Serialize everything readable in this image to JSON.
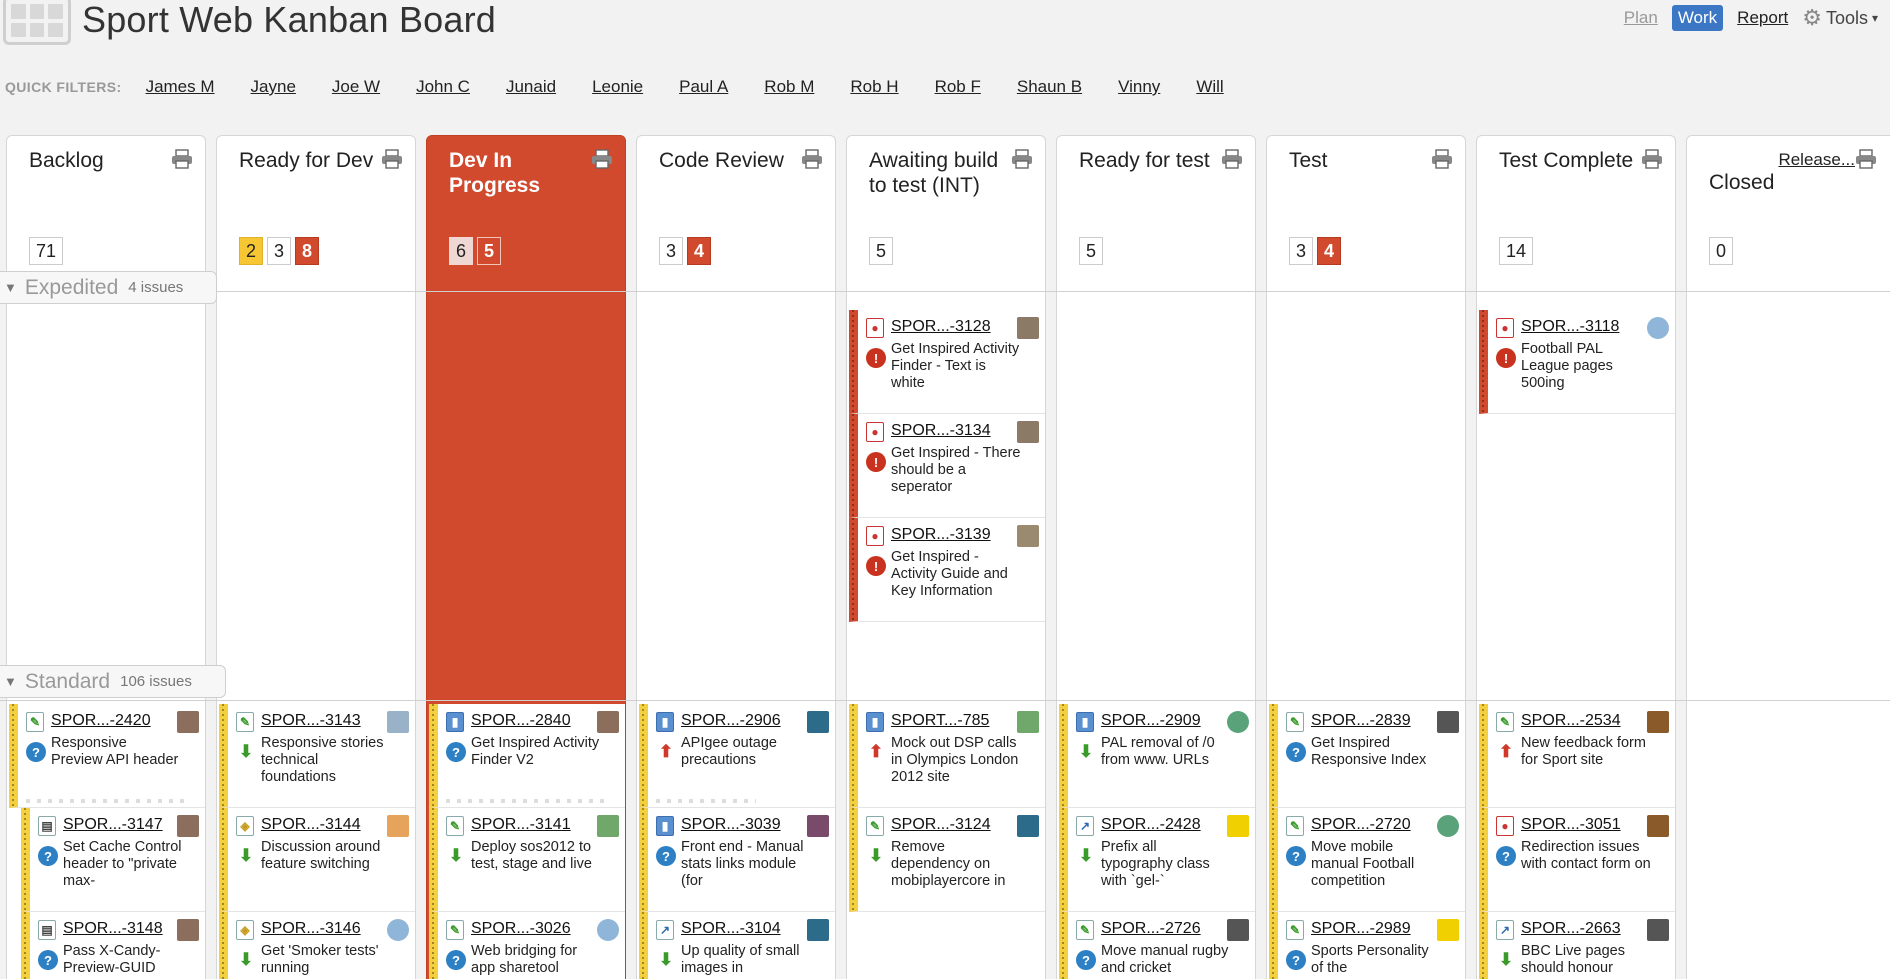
{
  "header": {
    "title": "Sport Web Kanban Board",
    "nav": {
      "plan": "Plan",
      "work": "Work",
      "report": "Report",
      "tools": "Tools"
    }
  },
  "quick_filters": {
    "label": "QUICK FILTERS:",
    "items": [
      "James M",
      "Jayne",
      "Joe W",
      "John C",
      "Junaid",
      "Leonie",
      "Paul A",
      "Rob M",
      "Rob H",
      "Rob F",
      "Shaun B",
      "Vinny",
      "Will"
    ]
  },
  "columns": [
    {
      "title": "Backlog",
      "counts": [
        "71"
      ]
    },
    {
      "title": "Ready for Dev",
      "counts": [
        "2",
        "3",
        "8"
      ]
    },
    {
      "title": "Dev In Progress",
      "counts": [
        "6",
        "5"
      ]
    },
    {
      "title": "Code Review",
      "counts": [
        "3",
        "4"
      ]
    },
    {
      "title": "Awaiting build to test (INT)",
      "counts": [
        "5"
      ]
    },
    {
      "title": "Ready for test",
      "counts": [
        "5"
      ]
    },
    {
      "title": "Test",
      "counts": [
        "3",
        "4"
      ]
    },
    {
      "title": "Test Complete",
      "counts": [
        "14"
      ]
    },
    {
      "title": "Closed",
      "link": "Release...",
      "counts": [
        "0"
      ]
    }
  ],
  "swimlanes": {
    "expedited": {
      "name": "Expedited",
      "count": "4 issues"
    },
    "standard": {
      "name": "Standard",
      "count": "106 issues"
    }
  },
  "cards": [
    {
      "key": "SPOR...-3128",
      "summary": "Get Inspired Activity Finder - Text is white",
      "icon": "bug-icon",
      "priority": "blocker"
    },
    {
      "key": "SPOR...-3134",
      "summary": "Get Inspired - There should be a seperator",
      "icon": "bug-icon",
      "priority": "blocker"
    },
    {
      "key": "SPOR...-3139",
      "summary": "Get Inspired - Activity Guide and Key Information",
      "icon": "bug-icon",
      "priority": "blocker"
    },
    {
      "key": "SPOR...-3118",
      "summary": "Football PAL League pages 500ing",
      "icon": "bug-icon",
      "priority": "blocker"
    },
    {
      "key": "SPOR...-2420",
      "summary": "Responsive Preview API header",
      "icon": "story-icon",
      "priority": "question"
    },
    {
      "key": "SPOR...-3147",
      "summary": "Set Cache Control header to \"private max-",
      "icon": "task-icon",
      "priority": "question"
    },
    {
      "key": "SPOR...-3148",
      "summary": "Pass X-Candy-Preview-GUID",
      "icon": "task-icon",
      "priority": "question"
    },
    {
      "key": "SPOR...-3143",
      "summary": "Responsive stories technical foundations",
      "icon": "story-icon",
      "priority": "down"
    },
    {
      "key": "SPOR...-3144",
      "summary": "Discussion around feature switching",
      "icon": "spike-icon",
      "priority": "down"
    },
    {
      "key": "SPOR...-3146",
      "summary": "Get 'Smoker tests' running",
      "icon": "spike-icon",
      "priority": "down"
    },
    {
      "key": "SPOR...-2840",
      "summary": "Get Inspired Activity Finder V2",
      "icon": "epic-icon",
      "priority": "question"
    },
    {
      "key": "SPOR...-3141",
      "summary": "Deploy sos2012 to test, stage and live",
      "icon": "story-icon",
      "priority": "down"
    },
    {
      "key": "SPOR...-3026",
      "summary": "Web bridging for app sharetool",
      "icon": "story-icon",
      "priority": "question"
    },
    {
      "key": "SPOR...-2906",
      "summary": "APIgee outage precautions",
      "icon": "epic-icon",
      "priority": "up"
    },
    {
      "key": "SPOR...-3039",
      "summary": "Front end - Manual stats links module (for",
      "icon": "epic-icon",
      "priority": "question"
    },
    {
      "key": "SPOR...-3104",
      "summary": "Up quality of small images in",
      "icon": "improve-icon",
      "priority": "down"
    },
    {
      "key": "SPORT...-785",
      "summary": "Mock out DSP calls in Olympics London 2012 site",
      "icon": "epic-icon",
      "priority": "up"
    },
    {
      "key": "SPOR...-3124",
      "summary": "Remove dependency on mobiplayercore in",
      "icon": "story-icon",
      "priority": "down"
    },
    {
      "key": "SPOR...-2909",
      "summary": "PAL removal of /0 from www. URLs",
      "icon": "epic-icon",
      "priority": "down"
    },
    {
      "key": "SPOR...-2428",
      "summary": "Prefix all typography class with `gel-`",
      "icon": "improve-icon",
      "priority": "down"
    },
    {
      "key": "SPOR...-2726",
      "summary": "Move manual rugby and cricket",
      "icon": "story-icon",
      "priority": "question"
    },
    {
      "key": "SPOR...-2839",
      "summary": "Get Inspired Responsive Index",
      "icon": "story-icon",
      "priority": "question"
    },
    {
      "key": "SPOR...-2720",
      "summary": "Move mobile manual Football competition",
      "icon": "story-icon",
      "priority": "question"
    },
    {
      "key": "SPOR...-2989",
      "summary": "Sports Personality of the",
      "icon": "story-icon",
      "priority": "question"
    },
    {
      "key": "SPOR...-2534",
      "summary": "New feedback form for Sport site",
      "icon": "story-icon",
      "priority": "up"
    },
    {
      "key": "SPOR...-3051",
      "summary": "Redirection issues with contact form on",
      "icon": "bug-icon",
      "priority": "question"
    },
    {
      "key": "SPOR...-2663",
      "summary": "BBC Live pages should honour",
      "icon": "improve-icon",
      "priority": "down"
    }
  ],
  "colors": {
    "active_column": "#d24a2e",
    "accent": "#3b77c5",
    "flag_yellow": "#f4d03f",
    "flag_red": "#d24a2e"
  }
}
